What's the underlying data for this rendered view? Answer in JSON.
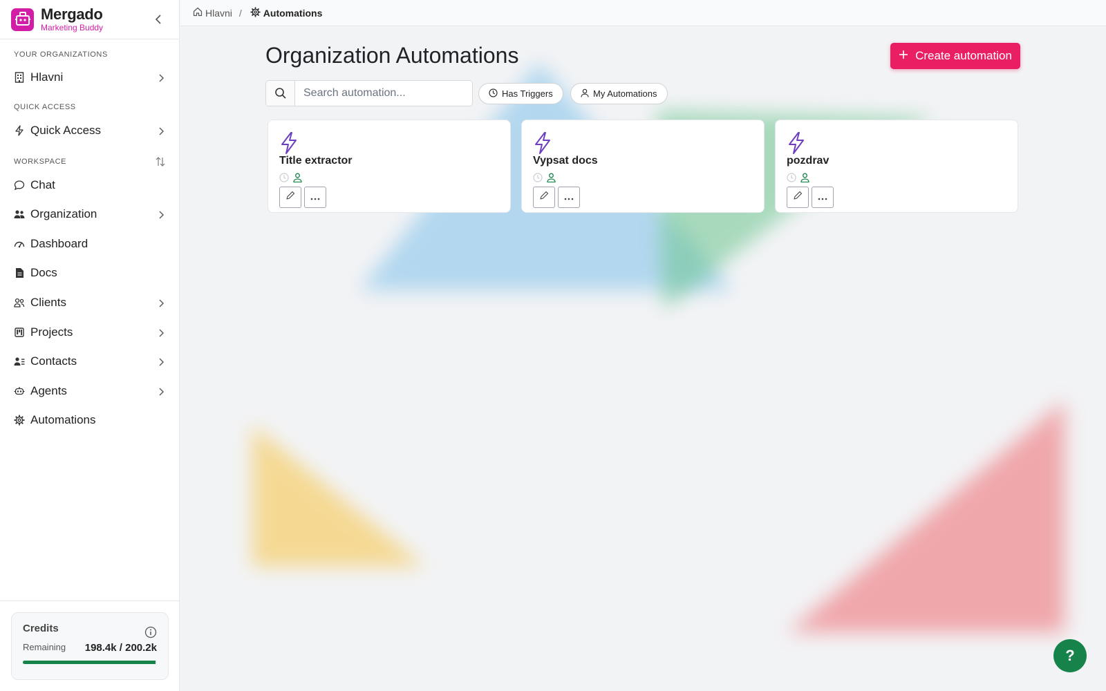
{
  "brand": {
    "name": "Mergado",
    "subtitle": "Marketing Buddy",
    "color": "#d21ea6"
  },
  "sidebar": {
    "org_section_label": "YOUR ORGANIZATIONS",
    "org_item": "Hlavni",
    "quick_section_label": "QUICK ACCESS",
    "quick_item": "Quick Access",
    "workspace_section_label": "WORKSPACE",
    "items": [
      {
        "label": "Chat",
        "icon": "chat-bubble-icon",
        "has_chevron": false
      },
      {
        "label": "Organization",
        "icon": "users-icon",
        "has_chevron": true
      },
      {
        "label": "Dashboard",
        "icon": "gauge-icon",
        "has_chevron": false
      },
      {
        "label": "Docs",
        "icon": "document-icon",
        "has_chevron": false
      },
      {
        "label": "Clients",
        "icon": "clients-icon",
        "has_chevron": true
      },
      {
        "label": "Projects",
        "icon": "kanban-icon",
        "has_chevron": true
      },
      {
        "label": "Contacts",
        "icon": "contact-card-icon",
        "has_chevron": true
      },
      {
        "label": "Agents",
        "icon": "robot-icon",
        "has_chevron": true
      },
      {
        "label": "Automations",
        "icon": "gear-icon",
        "has_chevron": false
      }
    ]
  },
  "credits": {
    "title": "Credits",
    "remaining_label": "Remaining",
    "remaining_value": "198.4k / 200.2k",
    "fraction": 0.991,
    "bar_color": "#16834a"
  },
  "breadcrumb": {
    "home": "Hlavni",
    "separator": "/",
    "current": "Automations"
  },
  "main": {
    "title": "Organization Automations",
    "create_button": "Create automation",
    "search_placeholder": "Search automation...",
    "filters": [
      "Has Triggers",
      "My Automations"
    ]
  },
  "cards": [
    {
      "title": "Title extractor"
    },
    {
      "title": "Vypsat docs"
    },
    {
      "title": "pozdrav"
    }
  ],
  "help_label": "?",
  "colors": {
    "accent": "#e91e63",
    "bolt": "#6d3fc0",
    "green": "#16834a"
  }
}
